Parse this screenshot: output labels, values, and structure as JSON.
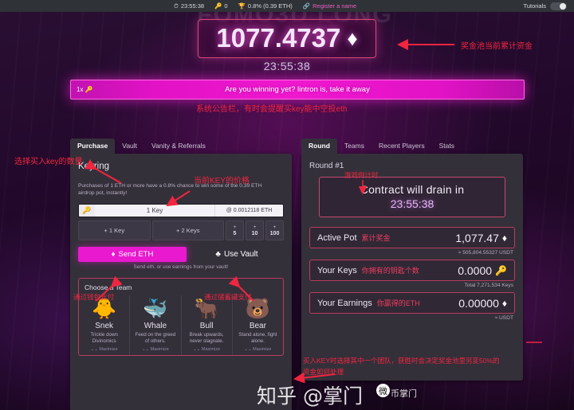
{
  "topbar": {
    "timer": "23:55:38",
    "keys_count": "0",
    "airdrop": "0.8% (0.39 ETH)",
    "register": "Register a name",
    "tutorials": "Tutorials",
    "icons": {
      "clock": "clock-icon",
      "key": "key-icon",
      "trophy": "trophy-icon",
      "link": "link-icon",
      "toggle": "toggle-switch"
    }
  },
  "ghost_title": "FOMO3D LONG",
  "pot": {
    "value": "1077.4737",
    "currency_symbol": "♦",
    "timer": "23:55:38"
  },
  "banner": {
    "multiplier": "1x",
    "message": "Are you winning yet? lintron is, take it away"
  },
  "left_panel": {
    "tabs": [
      {
        "label": "Purchase",
        "active": true
      },
      {
        "label": "Vault",
        "active": false
      },
      {
        "label": "Vanity & Referrals",
        "active": false
      }
    ],
    "heading": "Keyring",
    "description": "Purchases of 1 ETH or more have a 0.8% chance to win some of the 0.39 ETH airdrop pot, instantly!",
    "key_input": {
      "value": "1 Key",
      "placeholder": "1 Key",
      "price": "@ 0.0012118 ETH"
    },
    "quick_buttons": [
      {
        "label": "+ 1 Key"
      },
      {
        "label": "+ 2 Keys"
      }
    ],
    "stepper_buttons": [
      {
        "plus": "+",
        "num": "5"
      },
      {
        "plus": "+",
        "num": "10"
      },
      {
        "plus": "+",
        "num": "100"
      }
    ],
    "send_button": "Send ETH",
    "vault_button": "Use Vault",
    "action_note": "Send eth, or use earnings from your vault!",
    "team_title": "Choose a Team",
    "teams": [
      {
        "emoji": "🐥",
        "name": "Snek",
        "desc": "Trickle down Divinomics"
      },
      {
        "emoji": "🐳",
        "name": "Whale",
        "desc": "Feed on the greed of others."
      },
      {
        "emoji": "🐂",
        "name": "Bull",
        "desc": "Break upwards, never stagnate."
      },
      {
        "emoji": "🐻",
        "name": "Bear",
        "desc": "Stand alone, fight alone."
      }
    ],
    "team_more": "⌄⌄ Maximize"
  },
  "right_panel": {
    "tabs": [
      {
        "label": "Round",
        "active": true
      },
      {
        "label": "Teams",
        "active": false
      },
      {
        "label": "Recent Players",
        "active": false
      },
      {
        "label": "Stats",
        "active": false
      }
    ],
    "round_label": "Round #1",
    "drain_line1": "Contract will drain in",
    "drain_line2": "23:55:38",
    "stats": [
      {
        "label": "Active Pot",
        "cn": "累计奖金",
        "value": "1,077.47",
        "symbol": "♦",
        "sub": "≈ 505,804.55327 USDT"
      },
      {
        "label": "Your Keys",
        "cn": "你拥有的钥匙个数",
        "value": "0.0000",
        "symbol": "🔑",
        "sub": "Total 7,271.534 Keys"
      },
      {
        "label": "Your Earnings",
        "cn": "你赢得的ETH",
        "value": "0.00000",
        "symbol": "♦",
        "sub": "≈ USDT"
      }
    ]
  },
  "annotations": [
    {
      "id": "pot-note",
      "text": "奖金池当前累计资金"
    },
    {
      "id": "banner-note",
      "text": "系统公告栏，有时会提醒买key能中空投eth"
    },
    {
      "id": "buy-amount-note",
      "text": "选择买入key的数量"
    },
    {
      "id": "key-price-note",
      "text": "当前KEY的价格"
    },
    {
      "id": "wallet-pay-note",
      "text": "通过钱包支付"
    },
    {
      "id": "vault-pay-note",
      "text": "通过储蓄罐支付"
    },
    {
      "id": "countdown-note",
      "text": "游戏倒计时"
    },
    {
      "id": "team-note-1",
      "text": "买入KEY时选择其中一个团队，获胜时会决定奖金池里另変50%的"
    },
    {
      "id": "team-note-2",
      "text": "资金如何处理"
    }
  ],
  "watermark": {
    "main": "知乎 @掌门",
    "sub": "币掌门",
    "logo": "微"
  }
}
